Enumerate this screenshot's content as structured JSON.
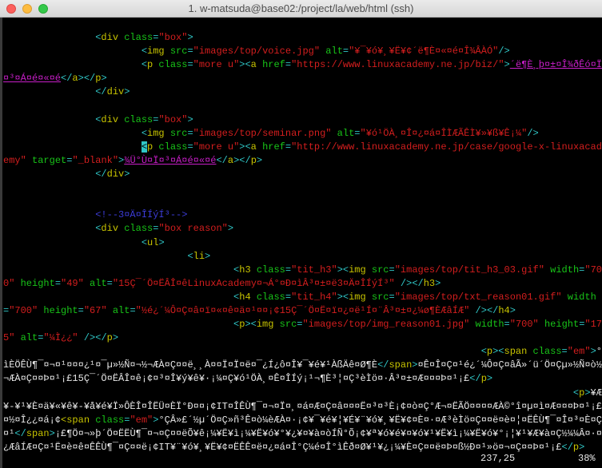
{
  "window": {
    "title": "1. w-matsuda@base02:/project/la/web/html (ssh)"
  },
  "editor": {
    "lines": [
      [
        [
          "t",
          ""
        ]
      ],
      [
        [
          "t",
          "                "
        ],
        [
          "b",
          "<"
        ],
        [
          "n",
          "div"
        ],
        [
          "a",
          " class"
        ],
        [
          "b",
          "="
        ],
        [
          "s",
          "\"box\""
        ],
        [
          "b",
          ">"
        ]
      ],
      [
        [
          "t",
          "                        "
        ],
        [
          "b",
          "<"
        ],
        [
          "n",
          "img"
        ],
        [
          "a",
          " src"
        ],
        [
          "b",
          "="
        ],
        [
          "s",
          "\"images/top/voice.jpg\""
        ],
        [
          "a",
          " alt"
        ],
        [
          "b",
          "="
        ],
        [
          "s",
          "\"¥¯¥ó¥¸¥Ë¥¢´ë¶È¤«¤é¤Î¾ÂÀÓ\""
        ],
        [
          "b",
          "/>"
        ]
      ],
      [
        [
          "t",
          "                        "
        ],
        [
          "b",
          "<"
        ],
        [
          "n",
          "p"
        ],
        [
          "a",
          " class"
        ],
        [
          "b",
          "="
        ],
        [
          "s",
          "\"more u\""
        ],
        [
          "b",
          "><"
        ],
        [
          "n",
          "a"
        ],
        [
          "a",
          " href"
        ],
        [
          "b",
          "="
        ],
        [
          "s",
          "\"https://www.linuxacademy.ne.jp/biz/\""
        ],
        [
          "b",
          ">"
        ],
        [
          "l",
          "´ë¶È¸þ¤±¤Î¾ðÊó¤Ï¤³¤Á¤é¤«¤é"
        ],
        [
          "b",
          "</"
        ],
        [
          "n",
          "a"
        ],
        [
          "b",
          "></"
        ],
        [
          "n",
          "p"
        ],
        [
          "b",
          ">"
        ]
      ],
      [
        [
          "t",
          "                "
        ],
        [
          "b",
          "</"
        ],
        [
          "n",
          "div"
        ],
        [
          "b",
          ">"
        ]
      ],
      [
        [
          "t",
          ""
        ]
      ],
      [
        [
          "t",
          "                "
        ],
        [
          "b",
          "<"
        ],
        [
          "n",
          "div"
        ],
        [
          "a",
          " class"
        ],
        [
          "b",
          "="
        ],
        [
          "s",
          "\"box\""
        ],
        [
          "b",
          ">"
        ]
      ],
      [
        [
          "t",
          "                        "
        ],
        [
          "b",
          "<"
        ],
        [
          "n",
          "img"
        ],
        [
          "a",
          " src"
        ],
        [
          "b",
          "="
        ],
        [
          "s",
          "\"images/top/seminar.png\""
        ],
        [
          "a",
          " alt"
        ],
        [
          "b",
          "="
        ],
        [
          "s",
          "\"¥ó¹ÖÀ¸¤Î¤¿¤á¤ÎÌÆÃÊÌ¥»¥ß¥Ê¡¼\""
        ],
        [
          "b",
          "/>"
        ]
      ],
      [
        [
          "t",
          "                        "
        ],
        [
          "cur",
          "<"
        ],
        [
          "n",
          "p"
        ],
        [
          "a",
          " class"
        ],
        [
          "b",
          "="
        ],
        [
          "s",
          "\"more u\""
        ],
        [
          "b",
          "><"
        ],
        [
          "n",
          "a"
        ],
        [
          "a",
          " href"
        ],
        [
          "b",
          "="
        ],
        [
          "s",
          "\"http://www.linuxacademy.ne.jp/case/google-x-linuxacademy\""
        ],
        [
          "a",
          " target"
        ],
        [
          "b",
          "="
        ],
        [
          "s",
          "\"_blank\""
        ],
        [
          "b",
          ">"
        ],
        [
          "l",
          "¾Ü°Ù¤Ï¤³¤Á¤é¤«¤é"
        ],
        [
          "b",
          "</"
        ],
        [
          "n",
          "a"
        ],
        [
          "b",
          "></"
        ],
        [
          "n",
          "p"
        ],
        [
          "b",
          ">"
        ]
      ],
      [
        [
          "t",
          "                "
        ],
        [
          "b",
          "</"
        ],
        [
          "n",
          "div"
        ],
        [
          "b",
          ">"
        ]
      ],
      [
        [
          "t",
          ""
        ]
      ],
      [
        [
          "t",
          ""
        ]
      ],
      [
        [
          "t",
          "                "
        ],
        [
          "c",
          "<!--3¤Ä¤ÎÍýÍ³-->"
        ]
      ],
      [
        [
          "t",
          "                "
        ],
        [
          "b",
          "<"
        ],
        [
          "n",
          "div"
        ],
        [
          "a",
          " class"
        ],
        [
          "b",
          "="
        ],
        [
          "s",
          "\"box reason\""
        ],
        [
          "b",
          ">"
        ]
      ],
      [
        [
          "t",
          "                        "
        ],
        [
          "b",
          "<"
        ],
        [
          "n",
          "ul"
        ],
        [
          "b",
          ">"
        ]
      ],
      [
        [
          "t",
          "                                "
        ],
        [
          "b",
          "<"
        ],
        [
          "n",
          "li"
        ],
        [
          "b",
          ">"
        ]
      ],
      [
        [
          "t",
          "                                        "
        ],
        [
          "b",
          "<"
        ],
        [
          "n",
          "h3"
        ],
        [
          "a",
          " class"
        ],
        [
          "b",
          "="
        ],
        [
          "s",
          "\"tit_h3\""
        ],
        [
          "b",
          "><"
        ],
        [
          "n",
          "img"
        ],
        [
          "a",
          " src"
        ],
        [
          "b",
          "="
        ],
        [
          "s",
          "\"images/top/tit_h3_03.gif\""
        ],
        [
          "a",
          " width"
        ],
        [
          "b",
          "="
        ],
        [
          "s",
          "\"700\""
        ],
        [
          "a",
          " height"
        ],
        [
          "b",
          "="
        ],
        [
          "s",
          "\"49\""
        ],
        [
          "a",
          " alt"
        ],
        [
          "b",
          "="
        ],
        [
          "s",
          "\"15Ç¯´Ö¤ËÂÎ¤êLinuxAcademy¤¬Á°¤Ð¤ìÂ³¤±¤ë3¤Ä¤ÎÍýÍ³\""
        ],
        [
          "b",
          " /></"
        ],
        [
          "n",
          "h3"
        ],
        [
          "b",
          ">"
        ]
      ],
      [
        [
          "t",
          "                                        "
        ],
        [
          "b",
          "<"
        ],
        [
          "n",
          "h4"
        ],
        [
          "a",
          " class"
        ],
        [
          "b",
          "="
        ],
        [
          "s",
          "\"tit_h4\""
        ],
        [
          "b",
          "><"
        ],
        [
          "n",
          "img"
        ],
        [
          "a",
          " src"
        ],
        [
          "b",
          "="
        ],
        [
          "s",
          "\"images/top/txt_reason01.gif\""
        ],
        [
          "a",
          " width"
        ],
        [
          "b",
          "="
        ],
        [
          "s",
          "\"700\""
        ],
        [
          "a",
          " height"
        ],
        [
          "b",
          "="
        ],
        [
          "s",
          "\"67\""
        ],
        [
          "a",
          " alt"
        ],
        [
          "b",
          "="
        ],
        [
          "s",
          "\"½é¿´¼Ô¤Ç¤â¤ï¤«¤ê¤ä¤¹¤¤¡¢15Ç¯´Ö¤Ë¤ï¤¿¤ë¹Í¤¨Â³¤±¤¿¼ø¶ÈÆâÍÆ\""
        ],
        [
          "b",
          " /></"
        ],
        [
          "n",
          "h4"
        ],
        [
          "b",
          ">"
        ]
      ],
      [
        [
          "t",
          "                                        "
        ],
        [
          "b",
          "<"
        ],
        [
          "n",
          "p"
        ],
        [
          "b",
          "><"
        ],
        [
          "n",
          "img"
        ],
        [
          "a",
          " src"
        ],
        [
          "b",
          "="
        ],
        [
          "s",
          "\"images/top/img_reason01.jpg\""
        ],
        [
          "a",
          " width"
        ],
        [
          "b",
          "="
        ],
        [
          "s",
          "\"700\""
        ],
        [
          "a",
          " height"
        ],
        [
          "b",
          "="
        ],
        [
          "s",
          "\"175\""
        ],
        [
          "a",
          " alt"
        ],
        [
          "b",
          "="
        ],
        [
          "s",
          "\"¼Ì¿¿\""
        ],
        [
          "b",
          " /></"
        ],
        [
          "n",
          "p"
        ],
        [
          "b",
          ">"
        ]
      ],
      [
        [
          "t",
          "                                                                                   "
        ],
        [
          "b",
          "<"
        ],
        [
          "n",
          "p"
        ],
        [
          "b",
          "><"
        ],
        [
          "n",
          "span"
        ],
        [
          "a",
          " class"
        ],
        [
          "b",
          "="
        ],
        [
          "s",
          "\"em\""
        ],
        [
          "b",
          ">"
        ],
        [
          "t",
          "°ìÈÖÊÙ¶¯¤¬¤¹¤¤¤¿¹¤¯µ»½Ñ¤¬½¬ÆÀ¤Ç¤­¤ë¸¸À¤¤Ï¤Ï¤ë¤¯¿Í¿ô¤Î¥¯¥é¥¹ÀßÄê¤Ø¶È"
        ],
        [
          "b",
          "</"
        ],
        [
          "n",
          "span"
        ],
        [
          "b",
          ">"
        ],
        [
          "t",
          "¤Ê¤Î¤Ç¤¹é¿´¼Ô¤Ç¤âÃ»´ü´Ö¤Çµ»½Ñ¤ò½¬ÆÀ¤Ç¤­¤Þ¤¹¡£15Ç¯´Ö¤ËÂÎ¤ê¡¢¤³¤Î¥ý¥ê¥·¡¼¤Ç¥ó¹ÖÀ¸¤Ê¤ÎÍý¡¹¬¶È³¦¤Ç³èÌö¤·Â³¤±¤Æ¤¤¤Þ¤¹¡£"
        ],
        [
          "b",
          "</"
        ],
        [
          "n",
          "p"
        ],
        [
          "b",
          ">"
        ]
      ],
      [
        [
          "t",
          "                                                                                                   "
        ],
        [
          "b",
          "<"
        ],
        [
          "n",
          "p"
        ],
        [
          "b",
          ">"
        ],
        [
          "t",
          "¥Æ¥-¥¹¥È¤ä¥«¥ê¥-¥å¥é¥Ï»ÔÈÎ¤ÎËÜ¤ÈÏ°Ð¤¤¡¢IT¤ÎÊÙ¶¯¤¬¤Ï¤¸¤á¤Æ¤Ç¤â¤¤¤Ë¤³¤³È¡¢¤ò¤Ç°Æ¬¤ËÃÖ¤¤¤¤ÆÀ©°î¤µ¤ì¤Æ¤¤¤Þ¤¹¡£¤½¤Î¿¿¤á¡¢"
        ],
        [
          "n",
          "<span"
        ],
        [
          "a",
          " class"
        ],
        [
          "b",
          "="
        ],
        [
          "s",
          "\"em\""
        ],
        [
          "b",
          ">"
        ],
        [
          "t",
          "°ÇÂ»£´½µ´Ö¤Ç»ñ³Ê¤ò¼èÆÀ¤·¡¢¥¯¥é¥¦¥É¥¨¥ó¥¸¥Ë¥¢¤È¤·¤Æ³èÌö¤Ç¤­¤ë¤è¤¦¤ËÊÙ¶¯¤Î¤³¤È¤Ç¤¹"
        ],
        [
          "b",
          "</"
        ],
        [
          "n",
          "span"
        ],
        [
          "b",
          ">"
        ],
        [
          "t",
          "¡£¶Ö¤¬»þ´Ö¤ËËÙ¶¯¤¬¤Ç¤­¤ëÕ¥ê¡¼¥Ë¥ì¡¼¥Ë¥ó¥°¥¿¥¤¥à¤òÍÑ°Õ¡¢¥ª¥ó¥é¥¤¥ó¥¹¥Ë¥ì¡¼¥Ë¥ó¥°¡¦¥¹¥Æ¥à¤Ç½¼¼Â¤·¤¿ÆâÍÆ¤Ç¤¹Ë¤è¤ê¤ÊÊÙ¶¯¤Ç¤­¤ë¡¢IT¥¨¥ó¥¸¥Ë¥¢¤ËÊÊ¤ë¤¿¤á¤Î°Ç¼é¤Î°ìÊð¤Ø¥¹¥¿¡¼¥È¤Ç¤­¤ë¤Þ¤ß½Ð¤¹»ö¤¬¤Ç¤­¤Þ¤¹¡£"
        ],
        [
          "b",
          "</"
        ],
        [
          "n",
          "p"
        ],
        [
          "b",
          ">"
        ]
      ]
    ],
    "cursor_position": "237,25",
    "scroll_percent": "38%"
  }
}
